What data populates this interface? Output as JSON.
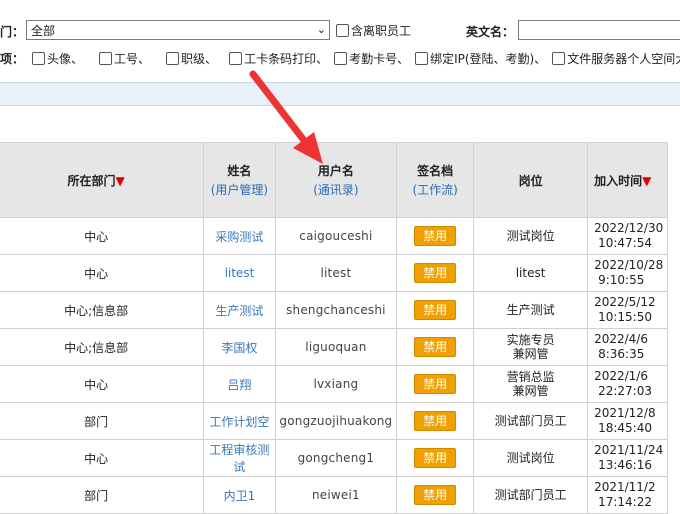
{
  "filters": {
    "dept_label": "门：",
    "dept_value": "全部",
    "include_resigned_label": "含离职员工",
    "english_name_label": "英文名：",
    "english_name_value": "",
    "columns_label": "项：",
    "column_options": [
      {
        "label": "头像、"
      },
      {
        "label": "工号、"
      },
      {
        "label": "职级、"
      },
      {
        "label": "工卡条码打印、"
      },
      {
        "label": "考勤卡号、"
      },
      {
        "label": "绑定IP(登陆、考勤)、"
      },
      {
        "label": "文件服务器个人空间大小"
      }
    ]
  },
  "table": {
    "headers": {
      "dept": "所在部门",
      "dept_sort": "▼",
      "name": "姓名",
      "name_sub": "(用户管理)",
      "username": "用户名",
      "username_sub": "(通讯录)",
      "signature": "签名档",
      "signature_sub": "(工作流)",
      "position": "岗位",
      "join_time": "加入时间",
      "join_sort": "▼"
    },
    "rows": [
      {
        "dept": "中心",
        "name": "采购测试",
        "username": "caigouceshi",
        "signature": "禁用",
        "position": "测试岗位",
        "date": "2022/12/30",
        "time": "10:47:54"
      },
      {
        "dept": "中心",
        "name": "litest",
        "username": "litest",
        "signature": "禁用",
        "position": "litest",
        "date": "2022/10/28",
        "time": "9:10:55"
      },
      {
        "dept": "中心;信息部",
        "name": "生产测试",
        "username": "shengchanceshi",
        "signature": "禁用",
        "position": "生产测试",
        "date": "2022/5/12",
        "time": "10:15:50"
      },
      {
        "dept": "中心;信息部",
        "name": "李国权",
        "username": "liguoquan",
        "signature": "禁用",
        "position": "实施专员\n兼网管",
        "date": "2022/4/6",
        "time": "8:36:35"
      },
      {
        "dept": "中心",
        "name": "吕翔",
        "username": "lvxiang",
        "signature": "禁用",
        "position": "营销总监\n兼网管",
        "date": "2022/1/6",
        "time": "22:27:03"
      },
      {
        "dept": "部门",
        "name": "工作计划空",
        "username": "gongzuojihuakong",
        "signature": "禁用",
        "position": "测试部门员工",
        "date": "2021/12/8",
        "time": "18:45:40"
      },
      {
        "dept": "中心",
        "name": "工程审核测试",
        "username": "gongcheng1",
        "signature": "禁用",
        "position": "测试岗位",
        "date": "2021/11/24",
        "time": "13:46:16"
      },
      {
        "dept": "部门",
        "name": "内卫1",
        "username": "neiwei1",
        "signature": "禁用",
        "position": "测试部门员工",
        "date": "2021/11/2",
        "time": "17:14:22"
      }
    ]
  },
  "colors": {
    "accent_orange": "#f0a000",
    "link_blue": "#3a78b8",
    "sort_red": "#e00000",
    "annotation_arrow": "#ee3333"
  }
}
